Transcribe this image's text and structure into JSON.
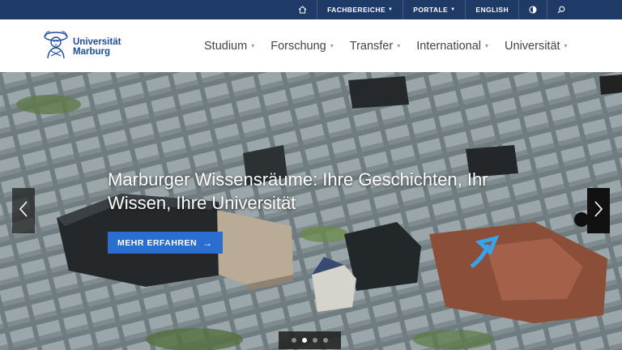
{
  "topbar": {
    "home_icon": "home-icon",
    "fachbereiche": "FACHBEREICHE",
    "portale": "PORTALE",
    "english": "ENGLISH",
    "contrast_icon": "contrast-icon",
    "search_icon": "search-icon"
  },
  "header": {
    "logo_line1": "Universität",
    "logo_line2": "Marburg",
    "nav": [
      "Studium",
      "Forschung",
      "Transfer",
      "International",
      "Universität"
    ]
  },
  "hero": {
    "title": "Marburger Wissensräume: Ihre Geschichten, Ihr Wissen, Ihre Universität",
    "cta_label": "MEHR ERFAHREN",
    "slide_count": 4,
    "active_slide": 2
  },
  "colors": {
    "topbar_bg": "#1e3a66",
    "brand_blue": "#1e4b9b",
    "cta_blue": "#2a6fd0"
  }
}
